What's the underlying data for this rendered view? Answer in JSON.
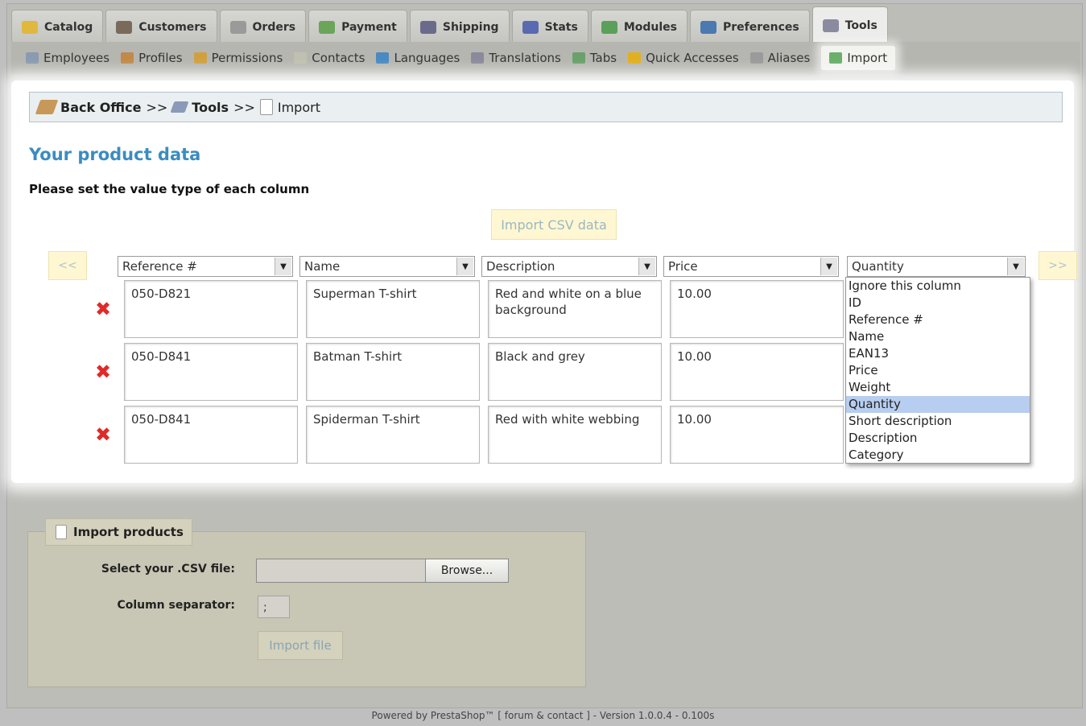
{
  "tabs": [
    {
      "label": "Catalog",
      "icon": "folder-icon",
      "color": "#e0b840"
    },
    {
      "label": "Customers",
      "icon": "user-icon",
      "color": "#7a6a5a"
    },
    {
      "label": "Orders",
      "icon": "orders-icon",
      "color": "#9a9a9a"
    },
    {
      "label": "Payment",
      "icon": "payment-icon",
      "color": "#6aa55a"
    },
    {
      "label": "Shipping",
      "icon": "truck-icon",
      "color": "#6a6a8a"
    },
    {
      "label": "Stats",
      "icon": "stats-icon",
      "color": "#5a6ab0"
    },
    {
      "label": "Modules",
      "icon": "modules-icon",
      "color": "#5aa05a"
    },
    {
      "label": "Preferences",
      "icon": "monitor-icon",
      "color": "#4a7ab0"
    },
    {
      "label": "Tools",
      "icon": "wrench-icon",
      "color": "#8a8aa0"
    }
  ],
  "subnav": [
    {
      "label": "Employees",
      "icon": "employees-icon",
      "color": "#8a9ab0"
    },
    {
      "label": "Profiles",
      "icon": "profiles-icon",
      "color": "#c08a4a"
    },
    {
      "label": "Permissions",
      "icon": "lock-icon",
      "color": "#d0a040"
    },
    {
      "label": "Contacts",
      "icon": "contacts-icon",
      "color": "#c0c0b0"
    },
    {
      "label": "Languages",
      "icon": "globe-icon",
      "color": "#4a8ac0"
    },
    {
      "label": "Translations",
      "icon": "translations-icon",
      "color": "#8a8a9a"
    },
    {
      "label": "Tabs",
      "icon": "tabs-icon",
      "color": "#6aa06a"
    },
    {
      "label": "Quick Accesses",
      "icon": "lightning-icon",
      "color": "#e0b020"
    },
    {
      "label": "Aliases",
      "icon": "search-icon",
      "color": "#9a9a9a"
    },
    {
      "label": "Import",
      "icon": "import-icon",
      "color": "#6ab06a"
    }
  ],
  "breadcrumb": {
    "root": "Back Office",
    "sep1": ">>",
    "middle": "Tools",
    "sep2": ">>",
    "current": "Import"
  },
  "title": "Your product data",
  "subtitle": "Please set the value type of each column",
  "import_csv_button": "Import CSV data",
  "nav": {
    "prev": "<<",
    "next": ">>"
  },
  "columns": [
    "Reference #",
    "Name",
    "Description",
    "Price",
    "Quantity"
  ],
  "rows": [
    [
      "050-D821",
      "Superman T-shirt",
      "Red and white on a blue background",
      "10.00"
    ],
    [
      "050-D841",
      "Batman T-shirt",
      "Black and grey",
      "10.00"
    ],
    [
      "050-D841",
      "Spiderman T-shirt",
      "Red with white webbing",
      "10.00"
    ]
  ],
  "delete_symbol": "✖",
  "dropdown": {
    "options": [
      "Ignore this column",
      "ID",
      "Reference #",
      "Name",
      "EAN13",
      "Price",
      "Weight",
      "Quantity",
      "Short description",
      "Description",
      "Category"
    ],
    "selected": "Quantity"
  },
  "import_products": {
    "legend": "Import products",
    "file_label": "Select your .CSV file:",
    "browse": "Browse...",
    "separator_label": "Column separator:",
    "separator_value": ";",
    "import_button": "Import file"
  },
  "footer": "Powered by PrestaShop™ [ forum & contact ] - Version 1.0.0.4 - 0.100s"
}
